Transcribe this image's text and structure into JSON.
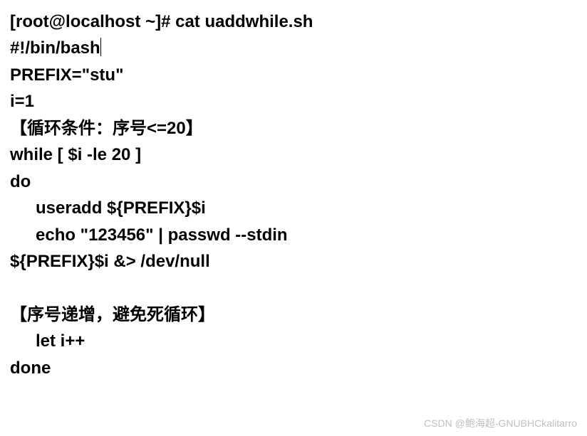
{
  "lines": {
    "l1": "[root@localhost ~]# cat uaddwhile.sh",
    "l2": "#!/bin/bash",
    "l3": "PREFIX=\"stu\"",
    "l4": "i=1",
    "l5": "【循环条件：序号<=20】",
    "l6": "while [ $i -le 20 ]",
    "l7": "do",
    "l8": "useradd ${PREFIX}$i",
    "l9": "echo \"123456\" | passwd --stdin",
    "l10": "${PREFIX}$i &> /dev/null",
    "l11": "",
    "l12": "【序号递增，避免死循环】",
    "l13": "let i++",
    "l14": "done"
  },
  "watermark": "CSDN @鲍海超-GNUBHCkalitarro"
}
